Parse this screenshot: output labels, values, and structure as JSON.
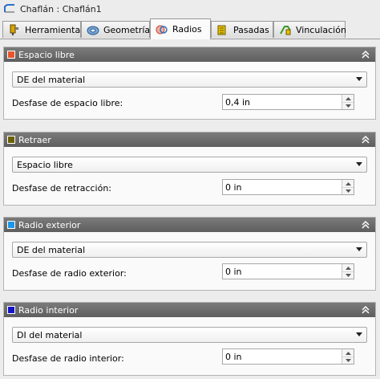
{
  "title": "Chaflán : Chaflán1",
  "tabs": [
    {
      "label": "Herramienta",
      "icon": "tool-icon",
      "active": false
    },
    {
      "label": "Geometría",
      "icon": "geometry-icon",
      "active": false
    },
    {
      "label": "Radios",
      "icon": "radii-icon",
      "active": true
    },
    {
      "label": "Pasadas",
      "icon": "passes-icon",
      "active": false
    },
    {
      "label": "Vinculación",
      "icon": "linking-icon",
      "active": false
    }
  ],
  "panels": [
    {
      "title": "Espacio libre",
      "color": "#e8562e",
      "select_value": "DE del material",
      "field_label": "Desfase de espacio libre:",
      "field_value": "0,4 in"
    },
    {
      "title": "Retraer",
      "color": "#6b6000",
      "select_value": "Espacio libre",
      "field_label": "Desfase de retracción:",
      "field_value": "0 in"
    },
    {
      "title": "Radio exterior",
      "color": "#1e96e6",
      "select_value": "DE del material",
      "field_label": "Desfase de radio exterior:",
      "field_value": "0 in"
    },
    {
      "title": "Radio interior",
      "color": "#1414c8",
      "select_value": "DI del material",
      "field_label": "Desfase de radio interior:",
      "field_value": "0 in"
    }
  ]
}
